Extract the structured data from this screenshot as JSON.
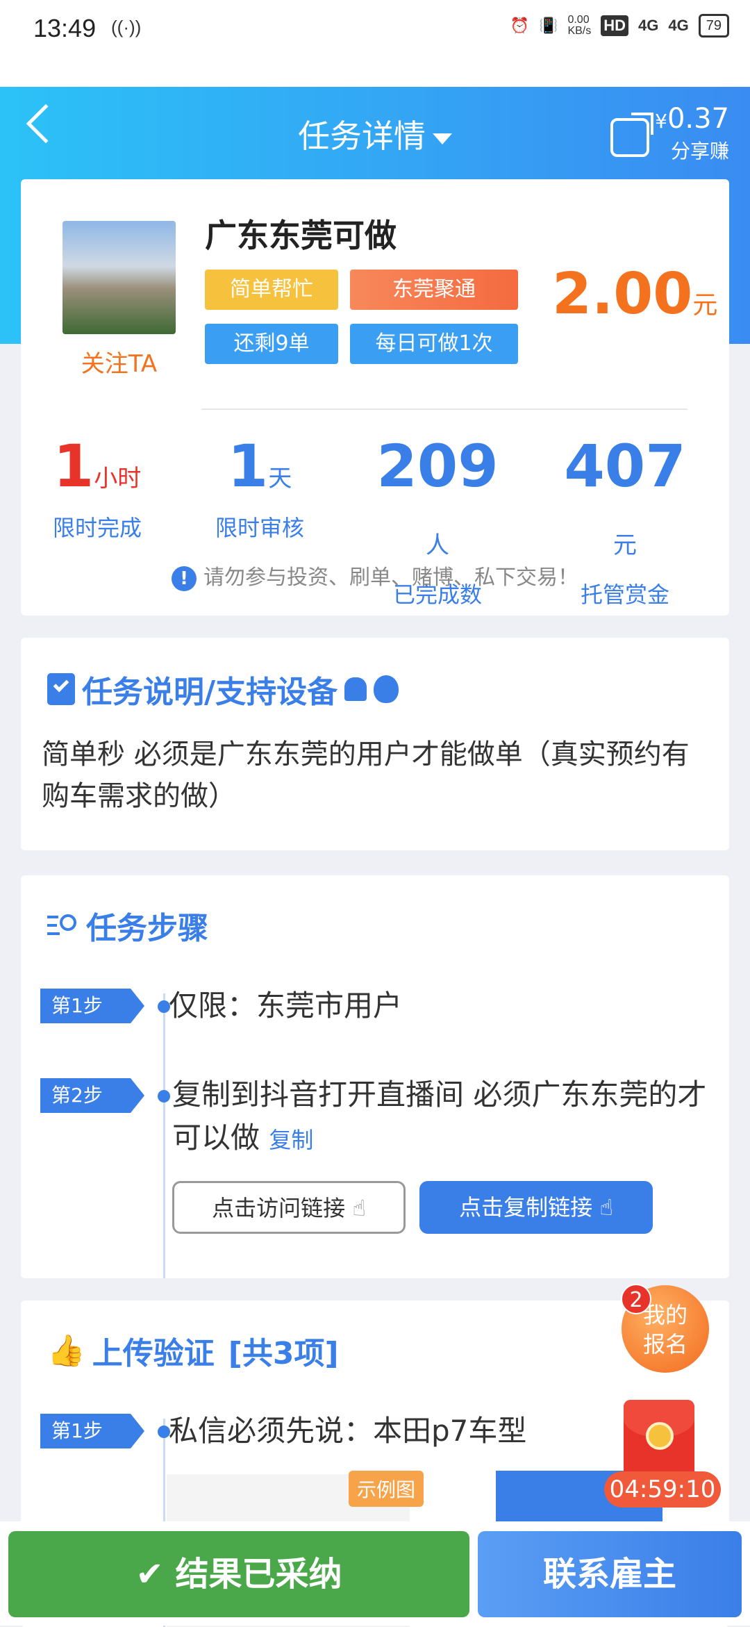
{
  "status_bar": {
    "time": "13:49",
    "signal_glyph": "((·))",
    "net_speed": "0.00\nKB/s",
    "hd_label": "HD",
    "net1": "4G",
    "net2": "4G",
    "battery": "79"
  },
  "header": {
    "title": "任务详情",
    "share_amount": "0.37",
    "share_currency": "¥",
    "share_label": "分享赚"
  },
  "task": {
    "name": "广东东莞可做",
    "follow_label": "关注TA",
    "tags": [
      "简单帮忙",
      "东莞聚通",
      "还剩9单",
      "每日可做1次"
    ],
    "price": "2.00",
    "price_unit": "元"
  },
  "stats": [
    {
      "value": "1",
      "unit": "小时",
      "label": "限时完成"
    },
    {
      "value": "1",
      "unit": "天",
      "label": "限时审核"
    },
    {
      "value": "209",
      "unit": "人",
      "label": "已完成数"
    },
    {
      "value": "407",
      "unit": "元",
      "label": "托管赏金"
    }
  ],
  "warning": "请勿参与投资、刷单、赌博、私下交易！",
  "description": {
    "title": "任务说明/支持设备",
    "text": "简单秒 必须是广东东莞的用户才能做单（真实预约有购车需求的做）"
  },
  "steps": {
    "title": "任务步骤",
    "items": [
      {
        "badge": "第1步",
        "text": "仅限：东莞市用户"
      },
      {
        "badge": "第2步",
        "text": "复制到抖音打开直播间 必须广东东莞的才可以做",
        "copy": "复制"
      }
    ],
    "visit_button": "点击访问链接",
    "copy_button": "点击复制链接"
  },
  "upload": {
    "title": "上传验证",
    "count": "[共3项]",
    "items": [
      {
        "badge": "第1步",
        "text": "私信必须先说：本田p7车型"
      }
    ],
    "sample_label": "示例图"
  },
  "float": {
    "badge": "2",
    "label1": "我的",
    "label2": "报名",
    "timer": "04:59:10"
  },
  "bottom": {
    "adopted": "结果已采纳",
    "contact": "联系雇主"
  },
  "colors": {
    "accent": "#3a7ee8",
    "orange": "#f4711d",
    "red": "#e8332b",
    "green": "#4aa84a"
  }
}
